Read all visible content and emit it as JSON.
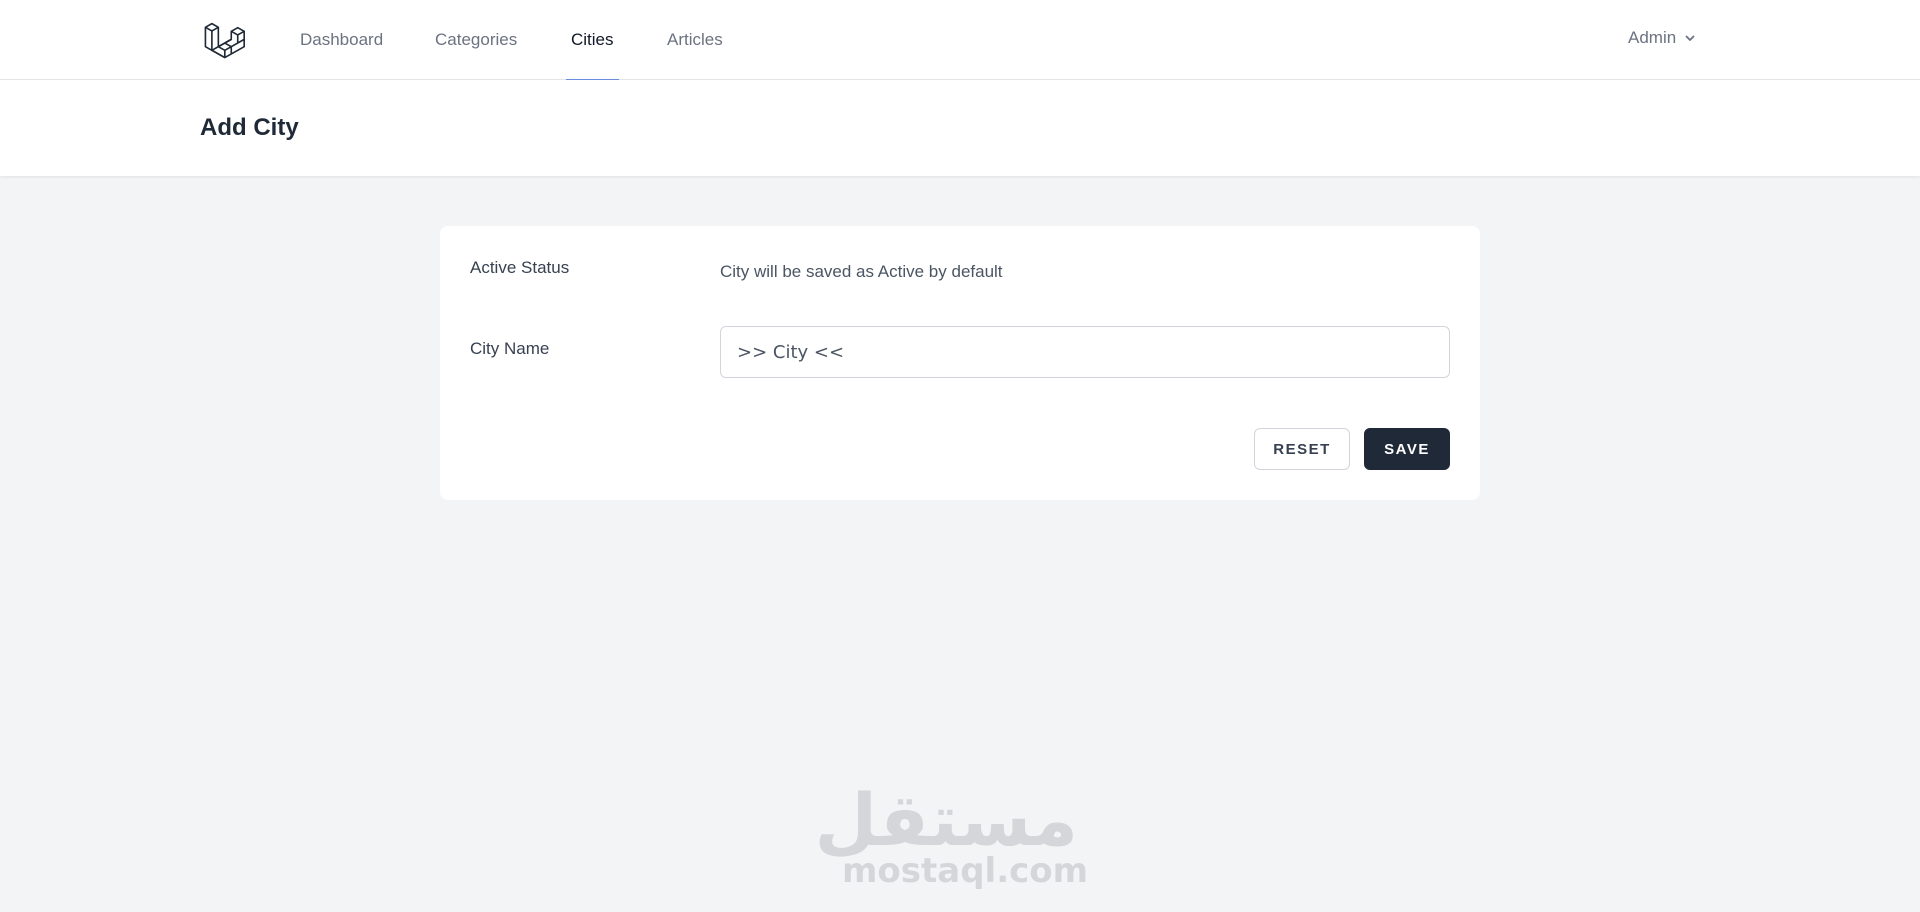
{
  "nav": {
    "logo_icon": "laravel-logo-icon",
    "links": [
      {
        "label": "Dashboard",
        "active": false
      },
      {
        "label": "Categories",
        "active": false
      },
      {
        "label": "Cities",
        "active": true
      },
      {
        "label": "Articles",
        "active": false
      }
    ],
    "user": {
      "label": "Admin",
      "icon": "chevron-down-icon"
    },
    "accent_color": "#6b8fe0"
  },
  "header": {
    "title": "Add City"
  },
  "form": {
    "status_label": "Active Status",
    "status_text": "City will be saved as Active by default",
    "city_label": "City Name",
    "city_value": ">> City <<",
    "reset_label": "RESET",
    "save_label": "SAVE",
    "save_color": "#1f2937"
  },
  "watermark": {
    "arabic": "مستقل",
    "latin": "mostaql.com"
  }
}
